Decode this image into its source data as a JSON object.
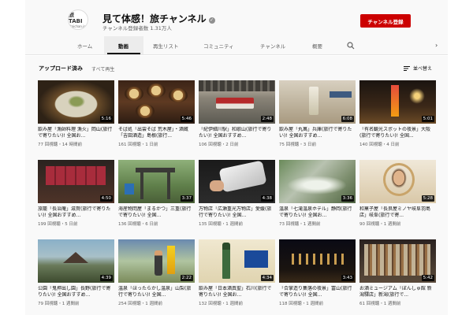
{
  "channel": {
    "avatar_text": "旅TABI",
    "avatar_sub": "taichan.jp",
    "name": "見て体感！旅チャンネル",
    "verified_glyph": "✓",
    "subscribers": "チャンネル登録者数 1.31万人",
    "subscribe_label": "チャンネル登録",
    "accent_color": "#cc0000"
  },
  "tabs": [
    {
      "label": "ホーム"
    },
    {
      "label": "動画"
    },
    {
      "label": "再生リスト"
    },
    {
      "label": "コミュニティ"
    },
    {
      "label": "チャンネル"
    },
    {
      "label": "概要"
    }
  ],
  "tab_icons": {
    "search": "search-icon",
    "scroll": "chevron-right-icon"
  },
  "section": {
    "title": "アップロード済み",
    "play_all": "すべて再生",
    "sort_label": "並べ替え"
  },
  "videos": [
    {
      "title": "飲み屋「漁師料理 漁火」岡山(旅行で寄りたい)! 全国お...",
      "meta": "77 回視聴・14 時間前",
      "duration": "5:16"
    },
    {
      "title": "そば処「出雲そば 荒木屋」・酒蔵「吉田酒造」島根(旅行...",
      "meta": "161 回視聴・1 日前",
      "duration": "5:46"
    },
    {
      "title": "「紀伊細川駅」和歌山(旅行で寄りたい)! 全国おすすめ...",
      "meta": "106 回視聴・2 日前",
      "duration": "2:48"
    },
    {
      "title": "飲み屋「丸萬」兵庫(旅行で寄りたい)! 全国おすすめ...",
      "meta": "75 回視聴・3 日前",
      "duration": "6:08"
    },
    {
      "title": "「有名観光スポットの夜景」大阪(旅行で寄りたい)! 全国...",
      "meta": "140 回視聴・4 日前",
      "duration": "5:01"
    },
    {
      "title": "旅籠「長治庵」滋賀(旅行で寄りたい)! 全国おすすめ...",
      "meta": "199 回視聴・5 日前",
      "duration": "4:50"
    },
    {
      "title": "海産物問屋「まるかつ」三重(旅行で寄りたい)! 全国...",
      "meta": "136 回視聴・6 日前",
      "duration": "3:37"
    },
    {
      "title": "万物店「広瀬重光万物店」愛媛(旅行で寄りたい)! 全国...",
      "meta": "135 回視聴・1 週間前",
      "duration": "4:38"
    },
    {
      "title": "温泉「七滝温泉ホテル」静岡(旅行で寄りたい)! 全国お...",
      "meta": "73 回視聴・1 週間前",
      "duration": "3:36"
    },
    {
      "title": "和菓子屋「長良屋ミノヤ岐阜羽島店」岐阜(旅行で寄...",
      "meta": "90 回視聴・1 週間前",
      "duration": "5:28"
    },
    {
      "title": "公園「鬼押出し園」長野(旅行で寄りたい)! 全国おすすめ...",
      "meta": "79 回視聴・1 週間前",
      "duration": "4:39"
    },
    {
      "title": "温泉「ほったらかし温泉」山梨(旅行で寄りたい)! 全国...",
      "meta": "254 回視聴・1 週間前",
      "duration": "2:22"
    },
    {
      "title": "飲み屋「日本酒真聖」石川(旅行で寄りたい)! 全国お...",
      "meta": "132 回視聴・1 週間前",
      "duration": "4:34"
    },
    {
      "title": "「合掌造り集落の夜景」富山(旅行で寄りたい)! 全国...",
      "meta": "118 回視聴・1 週間前",
      "duration": "3:43"
    },
    {
      "title": "お酒ミュージアム「ぽんしゅ館 新潟驛店」新潟(旅行で...",
      "meta": "61 回視聴・1 週間前",
      "duration": "5:42"
    }
  ]
}
